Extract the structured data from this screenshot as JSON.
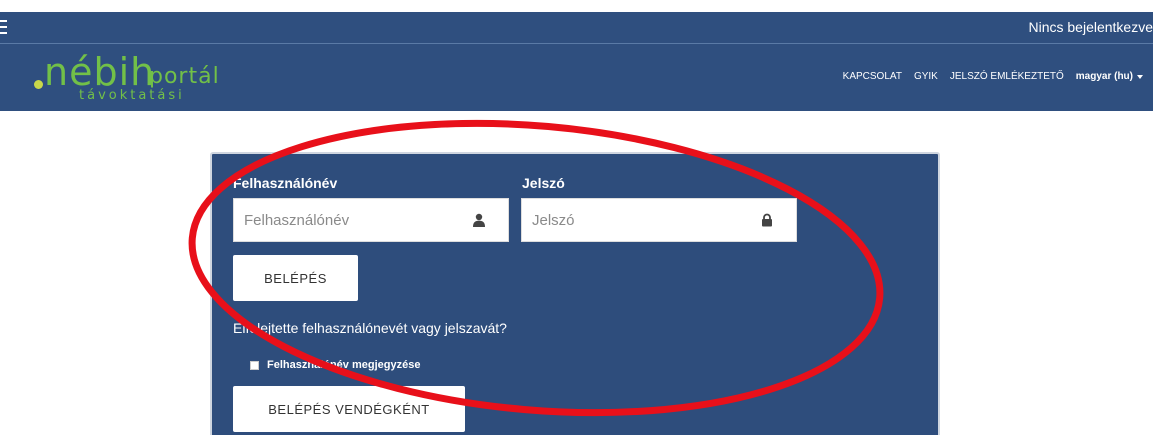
{
  "topbar": {
    "status": "Nincs bejelentkezve"
  },
  "brand": {
    "name": "nébih",
    "portal": "portál",
    "subtitle": "távoktatási"
  },
  "nav": {
    "items": [
      "KAPCSOLAT",
      "GYIK",
      "JELSZÓ EMLÉKEZTETŐ"
    ],
    "language": "magyar (hu)"
  },
  "login": {
    "username_label": "Felhasználónév",
    "username_placeholder": "Felhasználónév",
    "username_value": "",
    "password_label": "Jelszó",
    "password_placeholder": "Jelszó",
    "password_value": "",
    "login_button": "BELÉPÉS",
    "forgot_link": "Elfelejtette felhasználónevét vagy jelszavát?",
    "remember_label": "Felhasználónév megjegyzése",
    "remember_checked": false,
    "guest_button": "BELÉPÉS VENDÉGKÉNT"
  },
  "icons": {
    "username": "user-icon",
    "password": "lock-icon"
  },
  "colors": {
    "primary": "#2f4f7f",
    "brand_green": "#72c048",
    "annotation": "#e8101a"
  }
}
